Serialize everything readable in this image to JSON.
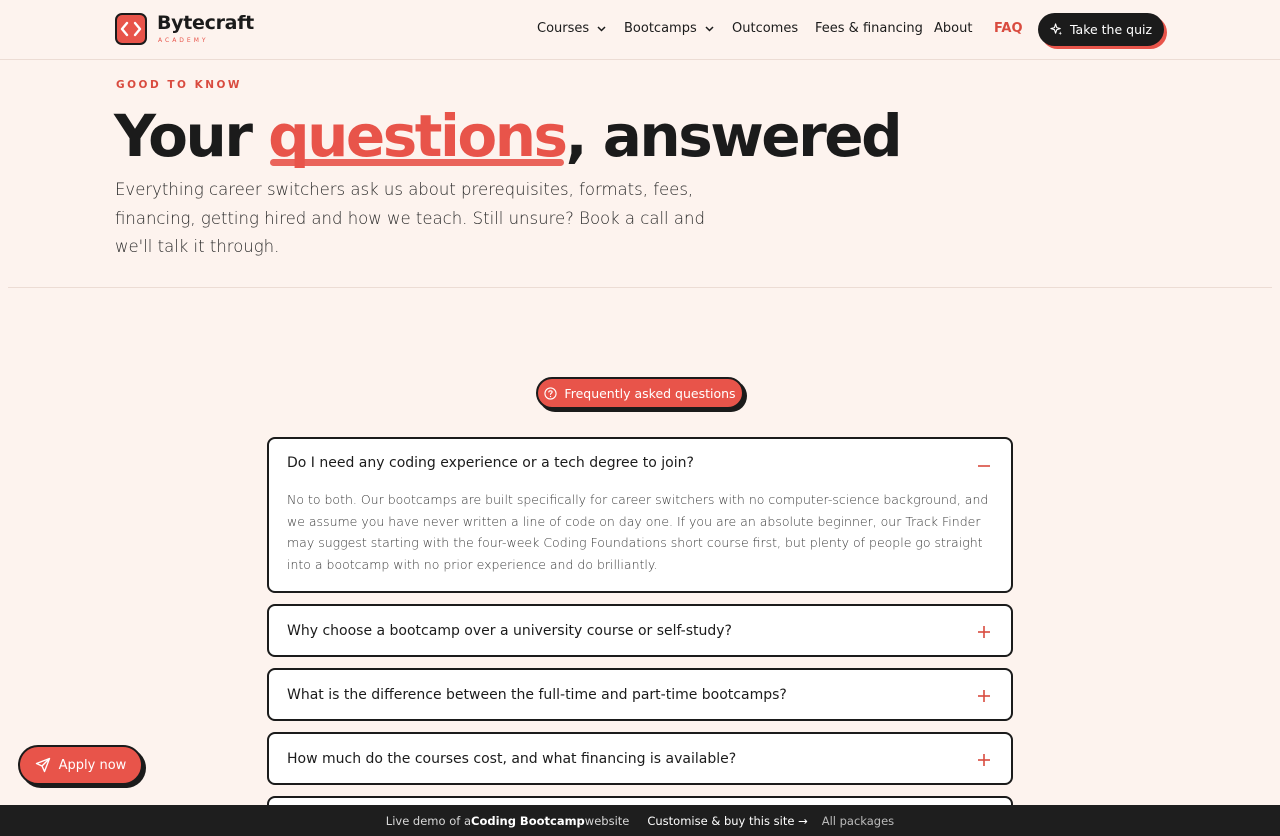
{
  "brand": {
    "name": "Bytecraft",
    "sub": "ACADEMY",
    "accent": "#e8544a"
  },
  "nav": {
    "items": [
      {
        "label": "Courses",
        "dropdown": true
      },
      {
        "label": "Bootcamps",
        "dropdown": true
      },
      {
        "label": "Outcomes"
      },
      {
        "label": "Fees & financing"
      },
      {
        "label": "About"
      },
      {
        "label": "FAQ",
        "active": true
      }
    ],
    "cta": "Take the quiz"
  },
  "hero": {
    "eyebrow": "GOOD TO KNOW",
    "title_pre": "Your ",
    "title_accent": "questions",
    "title_post": ", answered",
    "description": "Everything career switchers ask us about prerequisites, formats, fees, financing, getting hired and how we teach. Still unsure? Book a call and we'll talk it through."
  },
  "faq": {
    "pill_label": "Frequently asked questions",
    "items": [
      {
        "question": "Do I need any coding experience or a tech degree to join?",
        "answer": "No to both. Our bootcamps are built specifically for career switchers with no computer-science background, and we assume you have never written a line of code on day one. If you are an absolute beginner, our Track Finder may suggest starting with the four-week Coding Foundations short course first, but plenty of people go straight into a bootcamp with no prior experience and do brilliantly.",
        "expanded": true
      },
      {
        "question": "Why choose a bootcamp over a university course or self-study?",
        "expanded": false
      },
      {
        "question": "What is the difference between the full-time and part-time bootcamps?",
        "expanded": false
      },
      {
        "question": "How much do the courses cost, and what financing is available?",
        "expanded": false
      }
    ]
  },
  "apply": {
    "label": "Apply now"
  },
  "demo_bar": {
    "prefix": "Live demo of a ",
    "site": "Coding Bootcamp",
    "suffix": " website",
    "buy": "Customise & buy this site →",
    "packages": "All packages"
  }
}
